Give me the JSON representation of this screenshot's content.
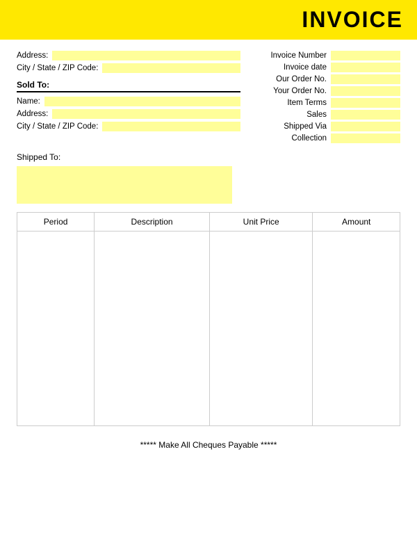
{
  "header": {
    "title": "INVOICE"
  },
  "left_top": {
    "address_label": "Address:",
    "city_label": "City / State / ZIP Code:"
  },
  "sold_to": {
    "label": "Sold To:",
    "name_label": "Name:",
    "address_label": "Address:",
    "city_label": "City / State / ZIP Code:"
  },
  "right_info": {
    "fields": [
      {
        "label": "Invoice Number"
      },
      {
        "label": "Invoice date"
      },
      {
        "label": "Our Order No."
      },
      {
        "label": "Your Order No."
      },
      {
        "label": "Item Terms"
      },
      {
        "label": "Sales"
      },
      {
        "label": "Shipped Via"
      },
      {
        "label": "Collection"
      }
    ]
  },
  "shipped_to": {
    "label": "Shipped To:"
  },
  "table": {
    "columns": [
      "Period",
      "Description",
      "Unit Price",
      "Amount"
    ]
  },
  "footer": {
    "text": "***** Make All Cheques Payable *****"
  }
}
